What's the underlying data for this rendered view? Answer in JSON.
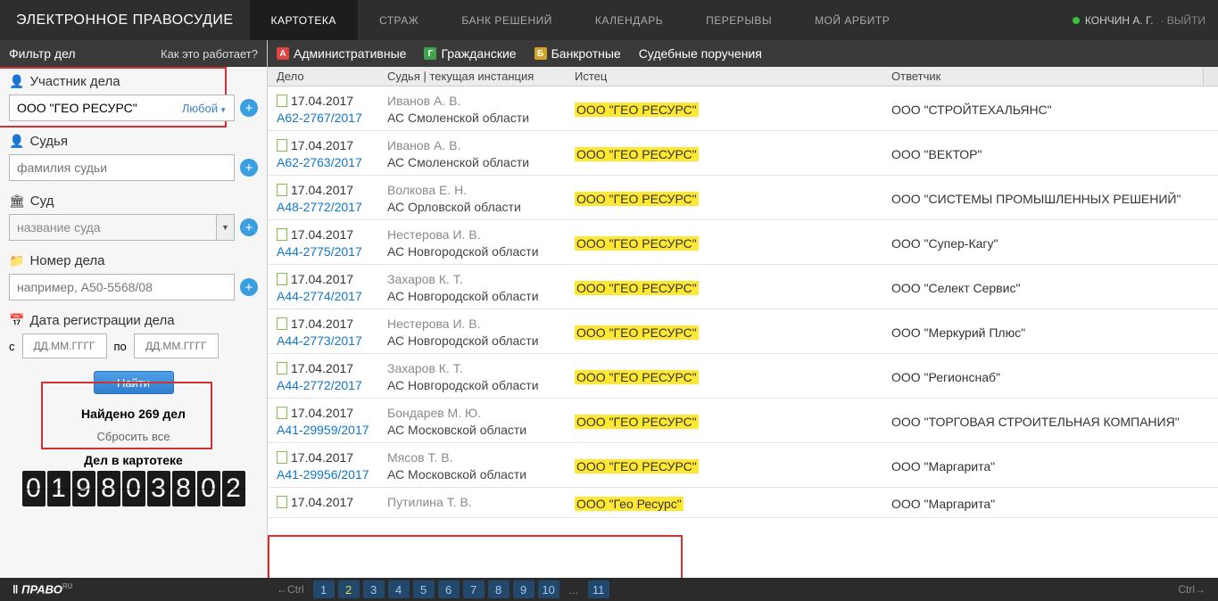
{
  "header": {
    "logo": "ЭЛЕКТРОННОЕ ПРАВОСУДИЕ",
    "tabs": [
      "КАРТОТЕКА",
      "СТРАЖ",
      "БАНК РЕШЕНИЙ",
      "КАЛЕНДАРЬ",
      "ПЕРЕРЫВЫ",
      "МОЙ АРБИТР"
    ],
    "active_tab": 0,
    "user": "КОНЧИН А. Г.",
    "logout": "ВЫЙТИ"
  },
  "sidebar": {
    "title": "Фильтр дел",
    "how": "Как это работает?",
    "participant": {
      "label": "Участник дела",
      "value": "ООО \"ГЕО РЕСУРС\"",
      "any": "Любой"
    },
    "judge": {
      "label": "Судья",
      "placeholder": "фамилия судьи"
    },
    "court": {
      "label": "Суд",
      "placeholder": "название суда"
    },
    "case": {
      "label": "Номер дела",
      "placeholder": "например, А50-5568/08"
    },
    "reg": {
      "label": "Дата регистрации дела",
      "from": "с",
      "to": "по",
      "placeholder": "ДД.ММ.ГГГГ"
    },
    "find": "Найти",
    "found": "Найдено 269 дел",
    "reset": "Сбросить все",
    "total_label": "Дел в картотеке",
    "counter": [
      "0",
      "1",
      "9",
      "8",
      "0",
      "3",
      "8",
      "0",
      "2"
    ]
  },
  "types": {
    "admin": "Административные",
    "civil": "Гражданские",
    "bank": "Банкротные",
    "assign": "Судебные поручения"
  },
  "grid": {
    "headers": {
      "case": "Дело",
      "judge": "Судья | текущая инстанция",
      "plaintiff": "Истец",
      "defendant": "Ответчик"
    },
    "rows": [
      {
        "date": "17.04.2017",
        "num": "А62-2767/2017",
        "judge": "Иванов А. В.",
        "court": "АС Смоленской области",
        "plaintiff": "ООО \"ГЕО РЕСУРС\"",
        "defendant": "ООО \"СТРОЙТЕХАЛЬЯНС\""
      },
      {
        "date": "17.04.2017",
        "num": "А62-2763/2017",
        "judge": "Иванов А. В.",
        "court": "АС Смоленской области",
        "plaintiff": "ООО \"ГЕО РЕСУРС\"",
        "defendant": "ООО \"ВЕКТОР\""
      },
      {
        "date": "17.04.2017",
        "num": "А48-2772/2017",
        "judge": "Волкова Е. Н.",
        "court": "АС Орловской области",
        "plaintiff": "ООО \"ГЕО РЕСУРС\"",
        "defendant": "ООО \"СИСТЕМЫ ПРОМЫШЛЕННЫХ РЕШЕНИЙ\""
      },
      {
        "date": "17.04.2017",
        "num": "А44-2775/2017",
        "judge": "Нестерова И. В.",
        "court": "АС Новгородской области",
        "plaintiff": "ООО \"ГЕО РЕСУРС\"",
        "defendant": "ООО \"Супер-Кагу\""
      },
      {
        "date": "17.04.2017",
        "num": "А44-2774/2017",
        "judge": "Захаров К. Т.",
        "court": "АС Новгородской области",
        "plaintiff": "ООО \"ГЕО РЕСУРС\"",
        "defendant": "ООО \"Селект Сервис\""
      },
      {
        "date": "17.04.2017",
        "num": "А44-2773/2017",
        "judge": "Нестерова И. В.",
        "court": "АС Новгородской области",
        "plaintiff": "ООО \"ГЕО РЕСУРС\"",
        "defendant": "ООО \"Меркурий Плюс\""
      },
      {
        "date": "17.04.2017",
        "num": "А44-2772/2017",
        "judge": "Захаров К. Т.",
        "court": "АС Новгородской области",
        "plaintiff": "ООО \"ГЕО РЕСУРС\"",
        "defendant": "ООО \"Регионснаб\""
      },
      {
        "date": "17.04.2017",
        "num": "А41-29959/2017",
        "judge": "Бондарев М. Ю.",
        "court": "АС Московской области",
        "plaintiff": "ООО \"ГЕО РЕСУРС\"",
        "defendant": "ООО \"ТОРГОВАЯ СТРОИТЕЛЬНАЯ КОМПАНИЯ\""
      },
      {
        "date": "17.04.2017",
        "num": "А41-29956/2017",
        "judge": "Мясов Т. В.",
        "court": "АС Московской области",
        "plaintiff": "ООО \"ГЕО РЕСУРС\"",
        "defendant": "ООО \"Маргарита\""
      },
      {
        "date": "17.04.2017",
        "num": "",
        "judge": "Путилина Т. В.",
        "court": "",
        "plaintiff": "ООО \"Гео Ресурс\"",
        "defendant": "ООО \"Маргарита\""
      }
    ]
  },
  "pager": {
    "prev": "←Ctrl",
    "next": "Ctrl→",
    "pages": [
      "1",
      "2",
      "3",
      "4",
      "5",
      "6",
      "7",
      "8",
      "9",
      "10",
      "...",
      "11"
    ],
    "active": 1
  },
  "brand": "ПРАВО",
  "brand_sup": "RU"
}
